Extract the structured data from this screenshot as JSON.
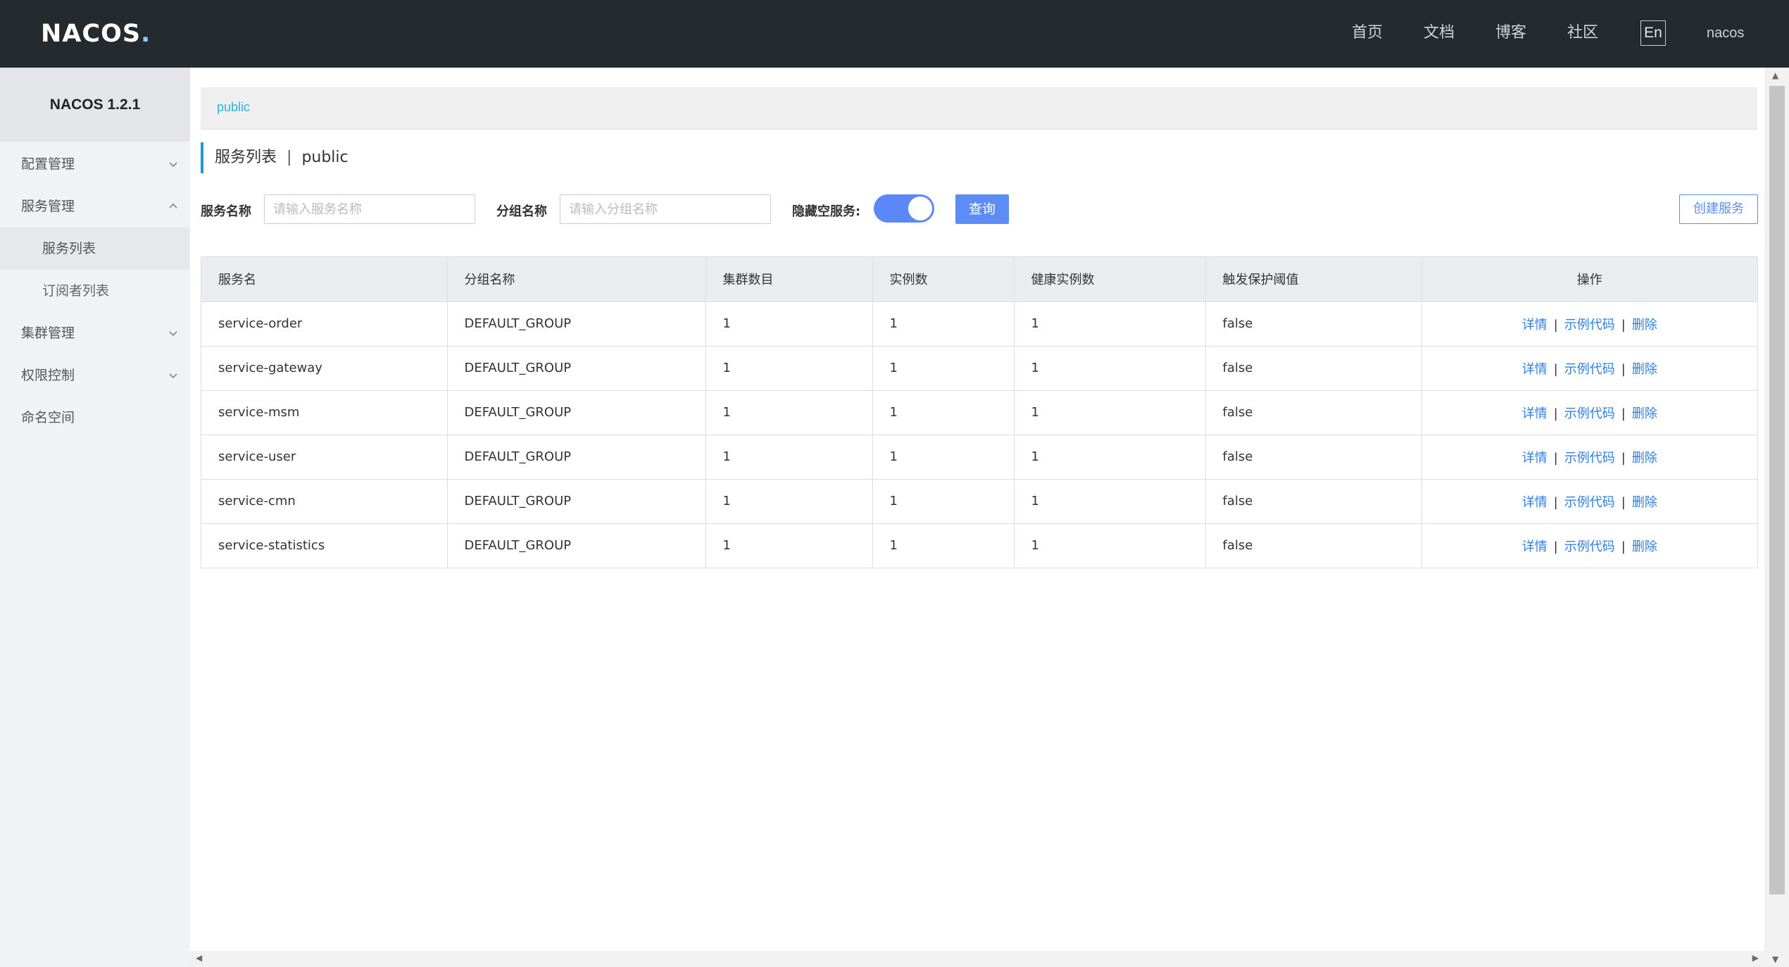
{
  "header": {
    "logo_text": "NACOS",
    "nav": {
      "home": "首页",
      "docs": "文档",
      "blog": "博客",
      "community": "社区",
      "lang": "En",
      "user": "nacos"
    }
  },
  "sidebar": {
    "version": "NACOS 1.2.1",
    "items": [
      {
        "label": "配置管理"
      },
      {
        "label": "服务管理"
      },
      {
        "label": "服务列表"
      },
      {
        "label": "订阅者列表"
      },
      {
        "label": "集群管理"
      },
      {
        "label": "权限控制"
      },
      {
        "label": "命名空间"
      }
    ]
  },
  "main": {
    "namespace_tab": "public",
    "title": "服务列表",
    "title_sep": "|",
    "title_namespace": "public",
    "filters": {
      "service_name_label": "服务名称",
      "service_name_placeholder": "请输入服务名称",
      "group_name_label": "分组名称",
      "group_name_placeholder": "请输入分组名称",
      "hide_empty_label": "隐藏空服务:",
      "hide_empty_on": true,
      "query_button": "查询",
      "create_button": "创建服务"
    },
    "table": {
      "columns": [
        "服务名",
        "分组名称",
        "集群数目",
        "实例数",
        "健康实例数",
        "触发保护阈值",
        "操作"
      ],
      "rows": [
        {
          "name": "service-order",
          "group": "DEFAULT_GROUP",
          "clusters": "1",
          "instances": "1",
          "healthy": "1",
          "threshold": "false"
        },
        {
          "name": "service-gateway",
          "group": "DEFAULT_GROUP",
          "clusters": "1",
          "instances": "1",
          "healthy": "1",
          "threshold": "false"
        },
        {
          "name": "service-msm",
          "group": "DEFAULT_GROUP",
          "clusters": "1",
          "instances": "1",
          "healthy": "1",
          "threshold": "false"
        },
        {
          "name": "service-user",
          "group": "DEFAULT_GROUP",
          "clusters": "1",
          "instances": "1",
          "healthy": "1",
          "threshold": "false"
        },
        {
          "name": "service-cmn",
          "group": "DEFAULT_GROUP",
          "clusters": "1",
          "instances": "1",
          "healthy": "1",
          "threshold": "false"
        },
        {
          "name": "service-statistics",
          "group": "DEFAULT_GROUP",
          "clusters": "1",
          "instances": "1",
          "healthy": "1",
          "threshold": "false"
        }
      ],
      "actions": {
        "detail": "详情",
        "sample": "示例代码",
        "delete": "删除",
        "sep": "|"
      }
    }
  },
  "colors": {
    "header_bg": "#252a2f",
    "accent": "#5c8cf6",
    "link": "#2f7fe3",
    "breadcrumb": "#2fb4d8"
  }
}
